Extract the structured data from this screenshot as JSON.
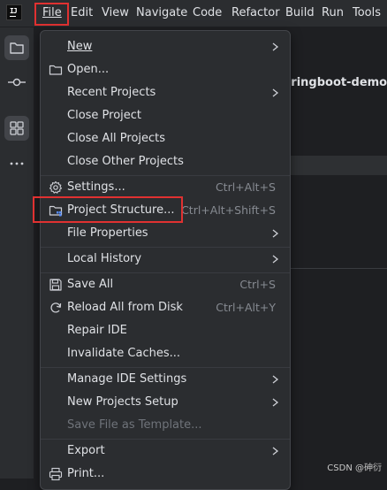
{
  "menubar": {
    "items": [
      {
        "label": "File"
      },
      {
        "label": "Edit"
      },
      {
        "label": "View"
      },
      {
        "label": "Navigate"
      },
      {
        "label": "Code"
      },
      {
        "label": "Refactor"
      },
      {
        "label": "Build"
      },
      {
        "label": "Run"
      },
      {
        "label": "Tools"
      }
    ]
  },
  "background": {
    "project_label": "pringboot-demo]"
  },
  "file_menu": {
    "items": [
      {
        "label": "New",
        "shortcut": "",
        "submenu": true
      },
      {
        "label": "Open...",
        "shortcut": "",
        "icon": "folder-icon"
      },
      {
        "label": "Recent Projects",
        "shortcut": "",
        "submenu": true
      },
      {
        "label": "Close Project",
        "shortcut": ""
      },
      {
        "label": "Close All Projects",
        "shortcut": ""
      },
      {
        "label": "Close Other Projects",
        "shortcut": ""
      },
      {
        "label": "Settings...",
        "shortcut": "Ctrl+Alt+S",
        "icon": "gear-icon"
      },
      {
        "label": "Project Structure...",
        "shortcut": "Ctrl+Alt+Shift+S",
        "icon": "project-structure-icon"
      },
      {
        "label": "File Properties",
        "shortcut": "",
        "submenu": true
      },
      {
        "label": "Local History",
        "shortcut": "",
        "submenu": true
      },
      {
        "label": "Save All",
        "shortcut": "Ctrl+S",
        "icon": "save-icon"
      },
      {
        "label": "Reload All from Disk",
        "shortcut": "Ctrl+Alt+Y",
        "icon": "reload-icon"
      },
      {
        "label": "Repair IDE",
        "shortcut": ""
      },
      {
        "label": "Invalidate Caches...",
        "shortcut": ""
      },
      {
        "label": "Manage IDE Settings",
        "shortcut": "",
        "submenu": true
      },
      {
        "label": "New Projects Setup",
        "shortcut": "",
        "submenu": true
      },
      {
        "label": "Save File as Template...",
        "shortcut": "",
        "disabled": true
      },
      {
        "label": "Export",
        "shortcut": "",
        "submenu": true
      },
      {
        "label": "Print...",
        "shortcut": "",
        "icon": "print-icon"
      }
    ]
  },
  "watermark": "CSDN @砷衍",
  "colors": {
    "highlight": "#e03131",
    "menu_bg": "#2b2d30",
    "text": "#dfe1e5",
    "shortcut": "#868a91",
    "disabled": "#6f737a"
  }
}
